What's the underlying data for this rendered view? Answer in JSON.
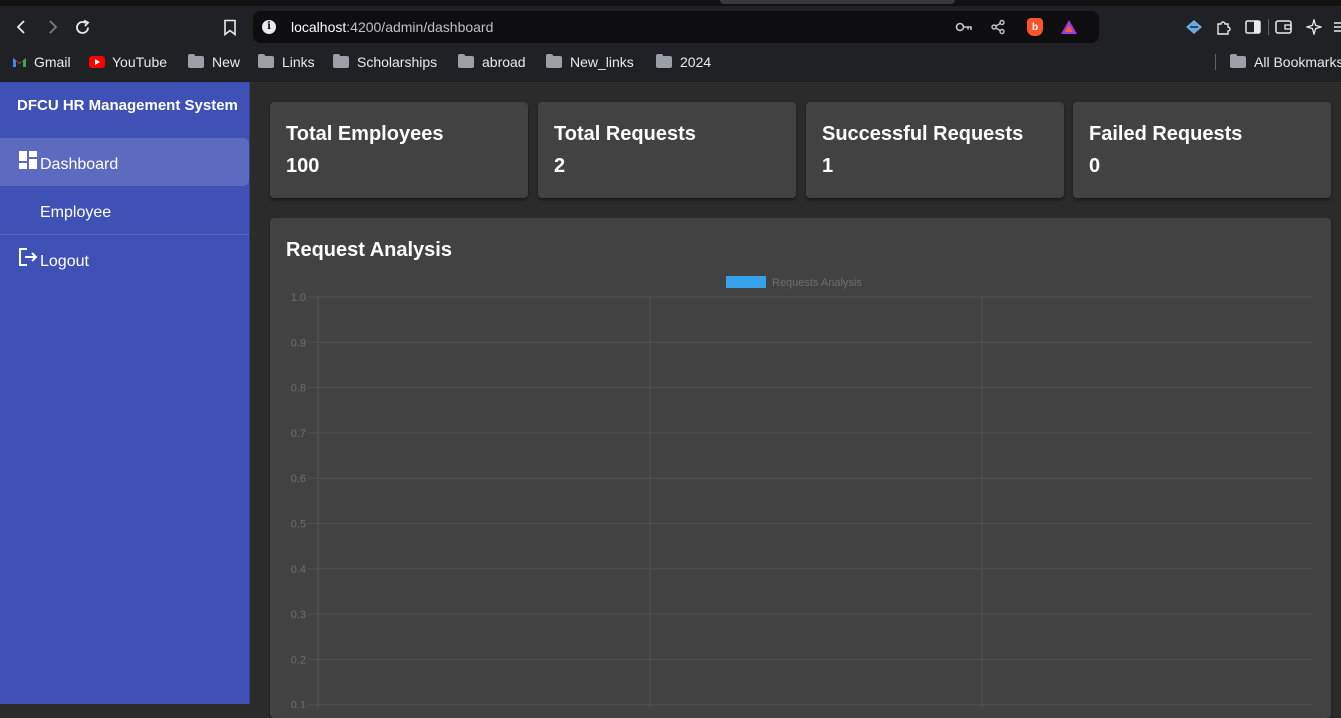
{
  "browser": {
    "url_host": "localhost",
    "url_path": ":4200/admin/dashboard",
    "bookmarks": [
      {
        "label": "Gmail",
        "icon": "gmail-icon"
      },
      {
        "label": "YouTube",
        "icon": "youtube-icon"
      },
      {
        "label": "New",
        "icon": "folder-icon"
      },
      {
        "label": "Links",
        "icon": "folder-icon"
      },
      {
        "label": "Scholarships",
        "icon": "folder-icon"
      },
      {
        "label": "abroad",
        "icon": "folder-icon"
      },
      {
        "label": "New_links",
        "icon": "folder-icon"
      },
      {
        "label": "2024",
        "icon": "folder-icon"
      }
    ],
    "all_bookmarks_label": "All Bookmarks"
  },
  "sidebar": {
    "brand": "DFCU HR Management System",
    "items": [
      {
        "label": "Dashboard",
        "icon": "dashboard-icon",
        "active": true
      },
      {
        "label": "Employee",
        "icon": "",
        "active": false
      },
      {
        "label": "Logout",
        "icon": "logout-icon",
        "active": false
      }
    ],
    "color": "#3f51b5",
    "active_color": "#5c6bc0"
  },
  "stats": [
    {
      "title": "Total Employees",
      "value": "100"
    },
    {
      "title": "Total Requests",
      "value": "2"
    },
    {
      "title": "Successful Requests",
      "value": "1"
    },
    {
      "title": "Failed Requests",
      "value": "0"
    }
  ],
  "chart_card": {
    "title": "Request Analysis"
  },
  "chart_data": {
    "type": "bar",
    "categories": [],
    "series": [
      {
        "name": "Requests Analysis",
        "values": [],
        "color": "#36a2eb"
      }
    ],
    "title": "",
    "xlabel": "",
    "ylabel": "",
    "ylim": [
      0,
      1
    ],
    "yticks": [
      "1.0",
      "0.9",
      "0.8",
      "0.7",
      "0.6",
      "0.5",
      "0.4",
      "0.3",
      "0.2",
      "0.1"
    ],
    "grid": true,
    "legend": "top"
  }
}
